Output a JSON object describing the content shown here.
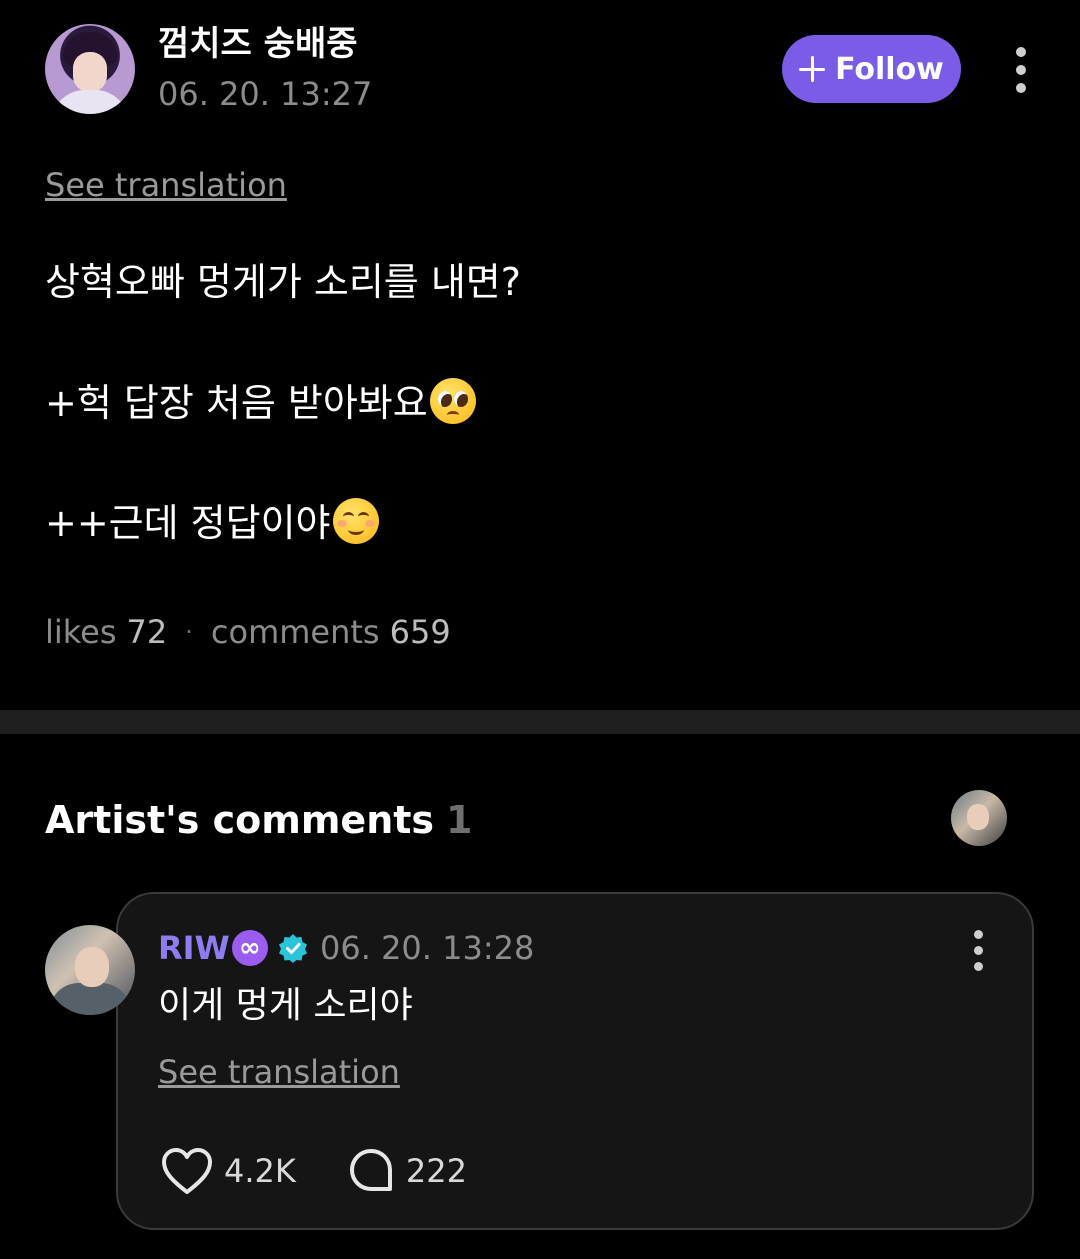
{
  "post": {
    "author_name": "껌치즈 숭배중",
    "timestamp": "06. 20. 13:27",
    "follow_label": "Follow",
    "see_translation": "See translation",
    "lines": [
      "상혁오빠 멍게가 소리를 내면?",
      "+헉 답장 처음 받아봐요",
      "++근데 정답이야"
    ],
    "line2_emoji": "pleading-face-emoji",
    "line3_emoji": "smiling-face-emoji",
    "likes_label": "likes",
    "likes_count": "72",
    "separator": "·",
    "comments_label": "comments",
    "comments_count": "659"
  },
  "artist_comments": {
    "title": "Artist's comments",
    "count": "1",
    "comment": {
      "author": "RIW",
      "badge_glyph": "∞",
      "verified_icon": "verified-badge-icon",
      "timestamp": "06. 20. 13:28",
      "text": "이게 멍게 소리야",
      "see_translation": "See translation",
      "likes": "4.2K",
      "replies": "222"
    }
  },
  "colors": {
    "background": "#000000",
    "accent": "#7a5ce6",
    "artist_name": "#8f7cf0",
    "verified": "#29c4d9",
    "muted_text": "#8c8c8c"
  }
}
